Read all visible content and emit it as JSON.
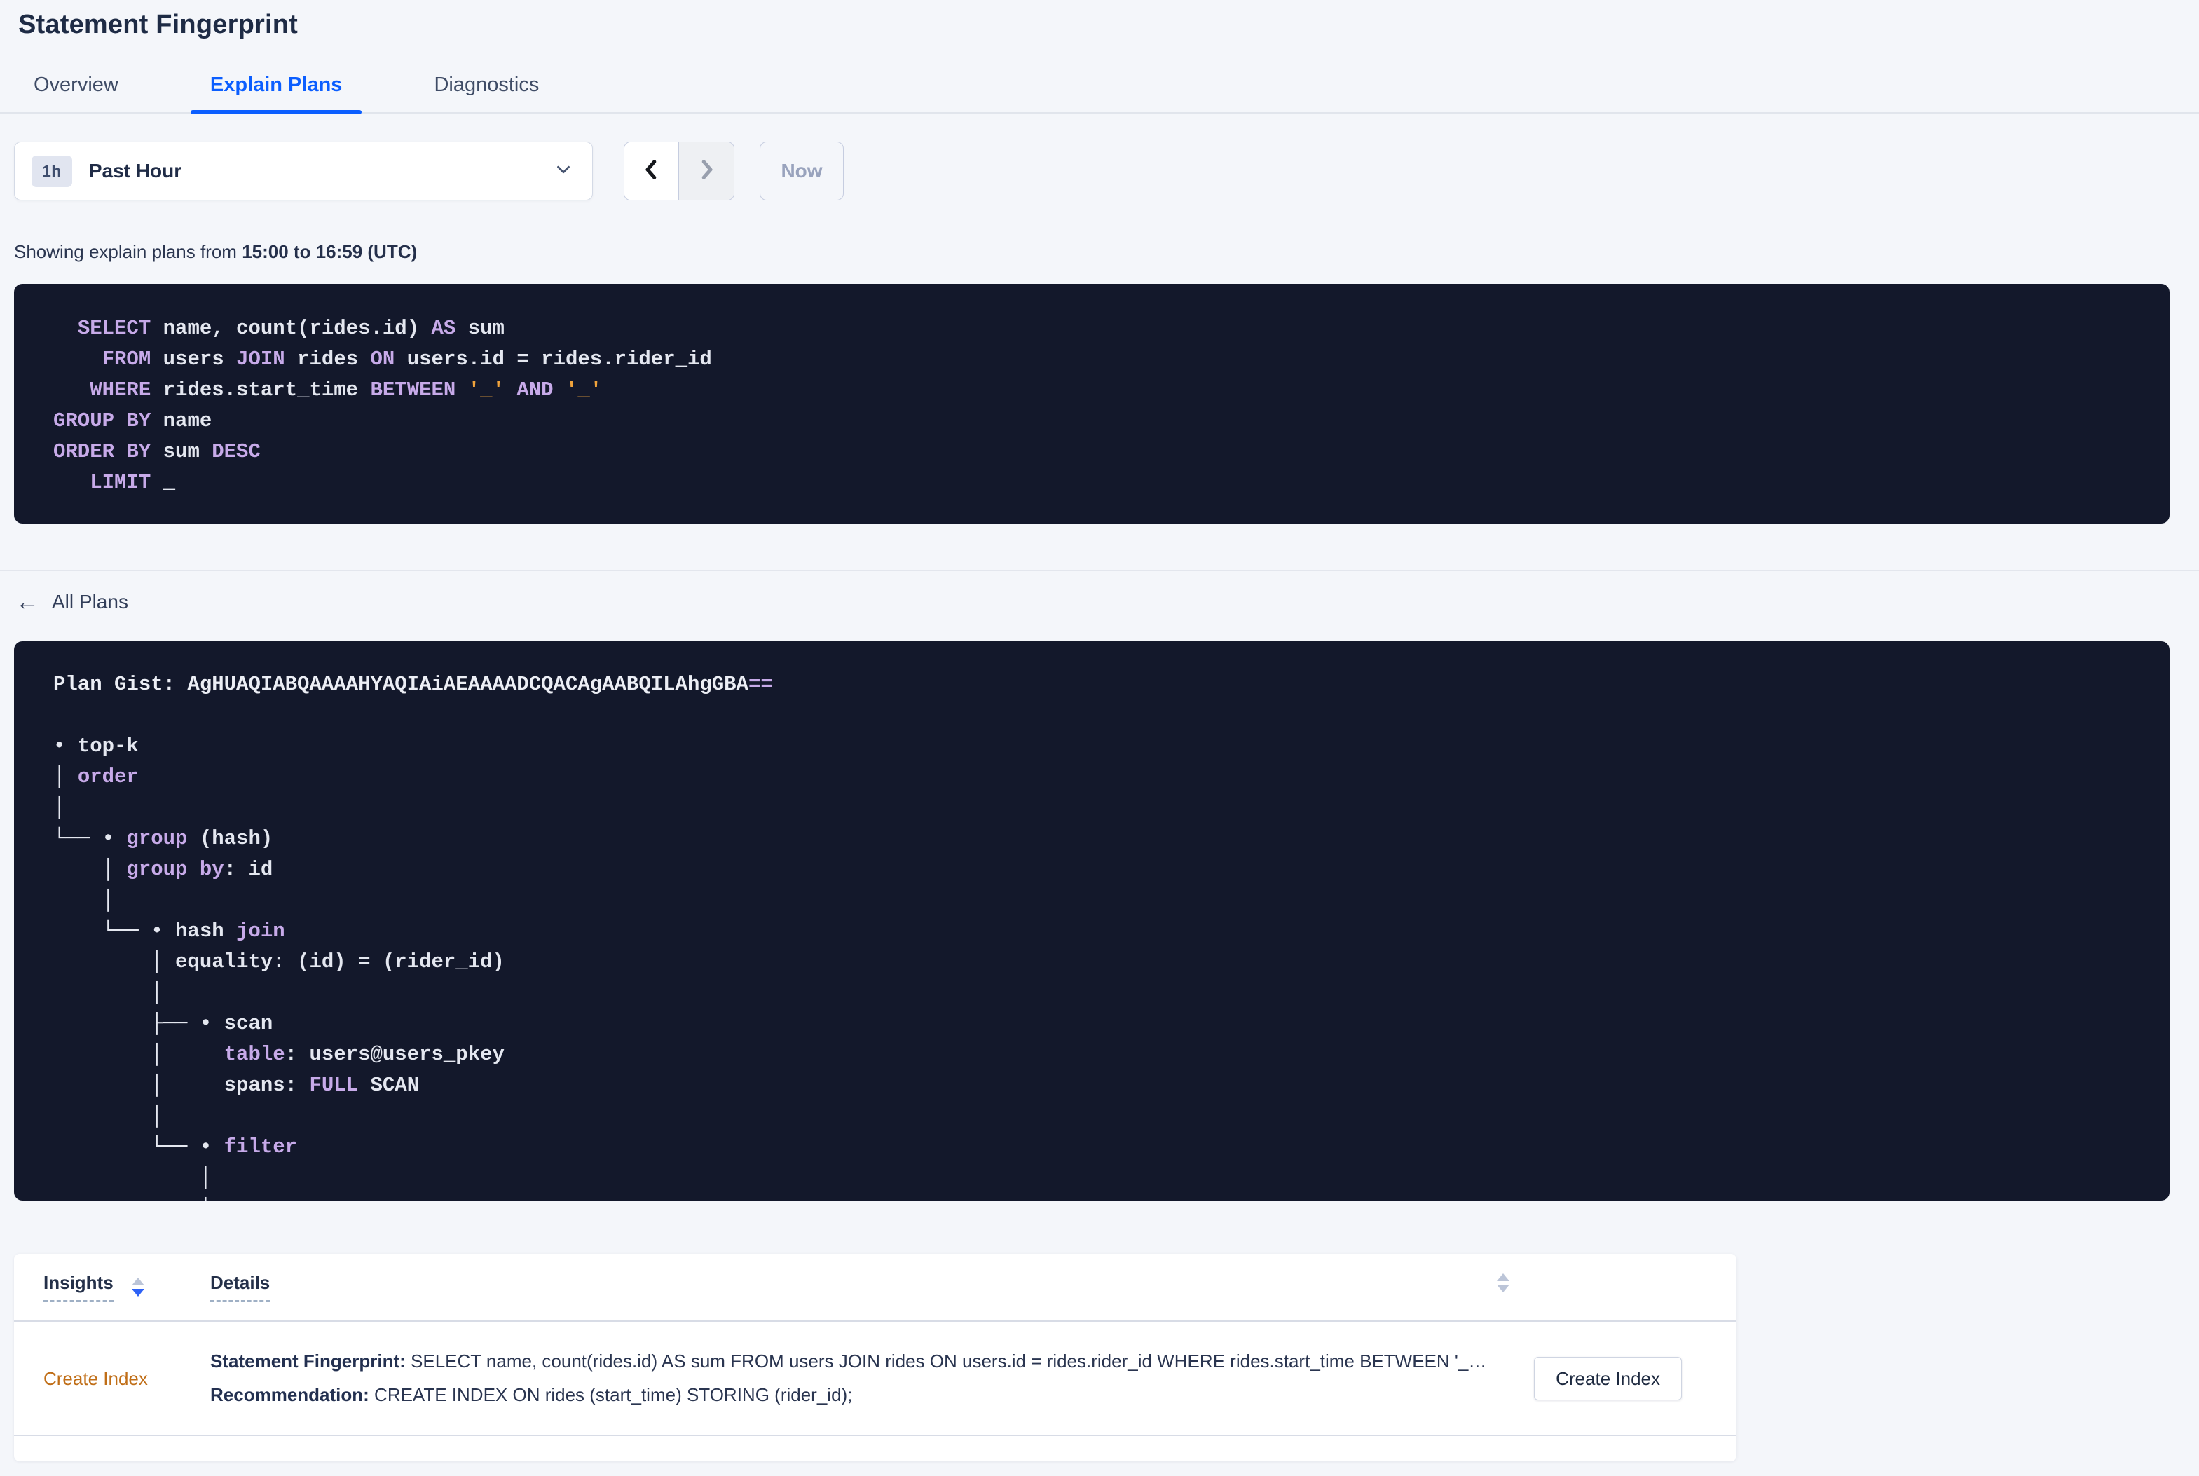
{
  "page": {
    "title": "Statement Fingerprint"
  },
  "tabs": [
    {
      "label": "Overview",
      "active": false
    },
    {
      "label": "Explain Plans",
      "active": true
    },
    {
      "label": "Diagnostics",
      "active": false
    }
  ],
  "time_selector": {
    "badge": "1h",
    "label": "Past Hour",
    "now_label": "Now"
  },
  "showing": {
    "prefix": "Showing explain plans from ",
    "range": "15:00 to 16:59 (UTC)"
  },
  "sql": {
    "lines": [
      [
        [
          "p",
          "  "
        ],
        [
          "k",
          "SELECT"
        ],
        [
          "p",
          " name, count(rides.id) "
        ],
        [
          "k",
          "AS"
        ],
        [
          "p",
          " sum"
        ]
      ],
      [
        [
          "p",
          "    "
        ],
        [
          "k",
          "FROM"
        ],
        [
          "p",
          " users "
        ],
        [
          "k",
          "JOIN"
        ],
        [
          "p",
          " rides "
        ],
        [
          "k",
          "ON"
        ],
        [
          "p",
          " users.id = rides.rider_id"
        ]
      ],
      [
        [
          "p",
          "   "
        ],
        [
          "k",
          "WHERE"
        ],
        [
          "p",
          " rides.start_time "
        ],
        [
          "k",
          "BETWEEN"
        ],
        [
          "p",
          " "
        ],
        [
          "s",
          "'_'"
        ],
        [
          "p",
          " "
        ],
        [
          "k",
          "AND"
        ],
        [
          "p",
          " "
        ],
        [
          "s",
          "'_'"
        ]
      ],
      [
        [
          "k",
          "GROUP BY"
        ],
        [
          "p",
          " name"
        ]
      ],
      [
        [
          "k",
          "ORDER BY"
        ],
        [
          "p",
          " sum "
        ],
        [
          "k",
          "DESC"
        ]
      ],
      [
        [
          "p",
          "   "
        ],
        [
          "k",
          "LIMIT"
        ],
        [
          "p",
          " _"
        ]
      ]
    ]
  },
  "all_plans": {
    "label": "All Plans",
    "arrow": "←"
  },
  "plan": {
    "gist": "Plan Gist: AgHUAQIABQAAAAHYAQIAiAEAAAADCQACAgAABQILAhgGBA==",
    "lines": [
      [
        [
          "g",
          "Plan Gist: AgHUAQIABQAAAAHYAQIAiAEAAAADCQACAgAABQILAhgGBA"
        ],
        [
          "k",
          "=="
        ]
      ],
      [
        [
          "p",
          ""
        ]
      ],
      [
        [
          "p",
          "• top-k"
        ]
      ],
      [
        [
          "p",
          "│ "
        ],
        [
          "k",
          "order"
        ]
      ],
      [
        [
          "p",
          "│"
        ]
      ],
      [
        [
          "p",
          "└── • "
        ],
        [
          "k",
          "group"
        ],
        [
          "p",
          " (hash)"
        ]
      ],
      [
        [
          "p",
          "    │ "
        ],
        [
          "k",
          "group by"
        ],
        [
          "p",
          ": id"
        ]
      ],
      [
        [
          "p",
          "    │"
        ]
      ],
      [
        [
          "p",
          "    └── • hash "
        ],
        [
          "k",
          "join"
        ]
      ],
      [
        [
          "p",
          "        │ equality: (id) = (rider_id)"
        ]
      ],
      [
        [
          "p",
          "        │"
        ]
      ],
      [
        [
          "p",
          "        ├── • scan"
        ]
      ],
      [
        [
          "p",
          "        │     "
        ],
        [
          "k",
          "table"
        ],
        [
          "p",
          ": users@users_pkey"
        ]
      ],
      [
        [
          "p",
          "        │     spans: "
        ],
        [
          "k",
          "FULL"
        ],
        [
          "p",
          " SCAN"
        ]
      ],
      [
        [
          "p",
          "        │"
        ]
      ],
      [
        [
          "p",
          "        └── • "
        ],
        [
          "k",
          "filter"
        ]
      ],
      [
        [
          "p",
          "            │"
        ]
      ],
      [
        [
          "p",
          "            │"
        ]
      ]
    ]
  },
  "insights_table": {
    "columns": {
      "insights": "Insights",
      "details": "Details"
    },
    "row": {
      "insight": "Create Index",
      "detail1_label": "Statement Fingerprint:",
      "detail1_text": " SELECT name, count(rides.id) AS sum FROM users JOIN rides ON users.id = rides.rider_id WHERE rides.start_time BETWEEN '_…",
      "detail2_label": "Recommendation:",
      "detail2_text": " CREATE INDEX ON rides (start_time) STORING (rider_id);",
      "action": "Create Index"
    }
  },
  "colors": {
    "accent_blue": "#0b5eff",
    "code_background": "#13182b",
    "keyword_purple": "#c7aae9",
    "string_orange": "#f0a33c",
    "insight_link_orange": "#c06e17",
    "page_background": "#f4f6fa"
  }
}
